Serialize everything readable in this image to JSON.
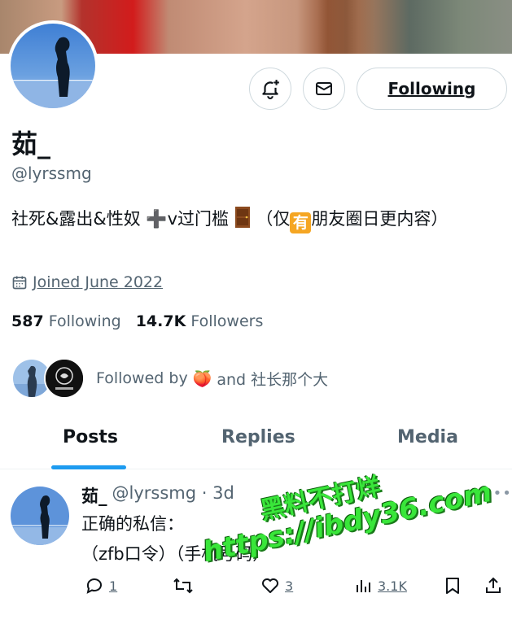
{
  "profile": {
    "display_name": "茹_",
    "handle": "@lyrssmg",
    "bio_part1": "社死&露出&性奴 ➕v过门槛",
    "bio_part2": "（仅",
    "bio_badge": "有",
    "bio_part3": "朋友圈日更内容）",
    "joined": "Joined June 2022",
    "following_count": "587",
    "following_label": "Following",
    "followers_count": "14.7K",
    "followers_label": "Followers"
  },
  "actions": {
    "following_button": "Following"
  },
  "followed_by": {
    "prefix": "Followed by",
    "emoji": "🍑",
    "suffix": "and 社长那个大"
  },
  "tabs": [
    {
      "label": "Posts"
    },
    {
      "label": "Replies"
    },
    {
      "label": "Media"
    }
  ],
  "post": {
    "name": "茹_",
    "meta": "@lyrssmg · 3d",
    "more": "•••",
    "line1": "正确的私信：",
    "line2": "（zfb口令）（手机号码）",
    "replies": "1",
    "likes": "3",
    "views": "3.1K"
  },
  "watermark": {
    "line1": "黑料不打烊",
    "line2": "https://ibdy36.com"
  },
  "colors": {
    "accent": "#1d9bf0",
    "text_primary": "#0f1419",
    "text_secondary": "#536471",
    "watermark_green": "#39e63a"
  }
}
